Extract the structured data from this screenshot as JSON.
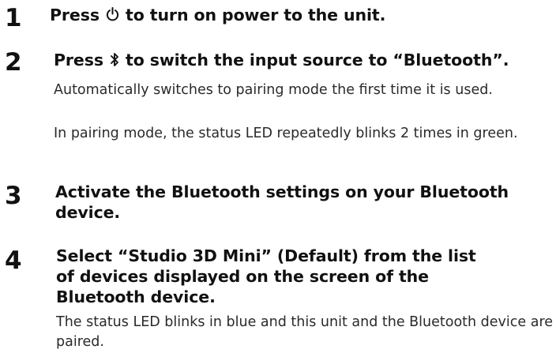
{
  "steps": [
    {
      "number": "1",
      "icon": "power-icon",
      "text_before_icon": "Press ",
      "text_after_icon": " to turn on power to the unit.",
      "notes": []
    },
    {
      "number": "2",
      "icon": "bluetooth-icon",
      "text_before_icon": "Press ",
      "text_after_icon": " to switch the input source to “Bluetooth”.",
      "notes": [
        "Automatically switches to pairing mode the first time it is used.",
        "In pairing mode, the status LED repeatedly blinks 2 times in green."
      ]
    },
    {
      "number": "3",
      "text": "Activate the Bluetooth settings on your Bluetooth device.",
      "notes": []
    },
    {
      "number": "4",
      "text": "Select “Studio 3D Mini” (Default) from the list of devices displayed on the screen of the Bluetooth device.",
      "notes": [
        "The status LED blinks in blue and this unit and the Bluetooth device are paired."
      ]
    }
  ]
}
